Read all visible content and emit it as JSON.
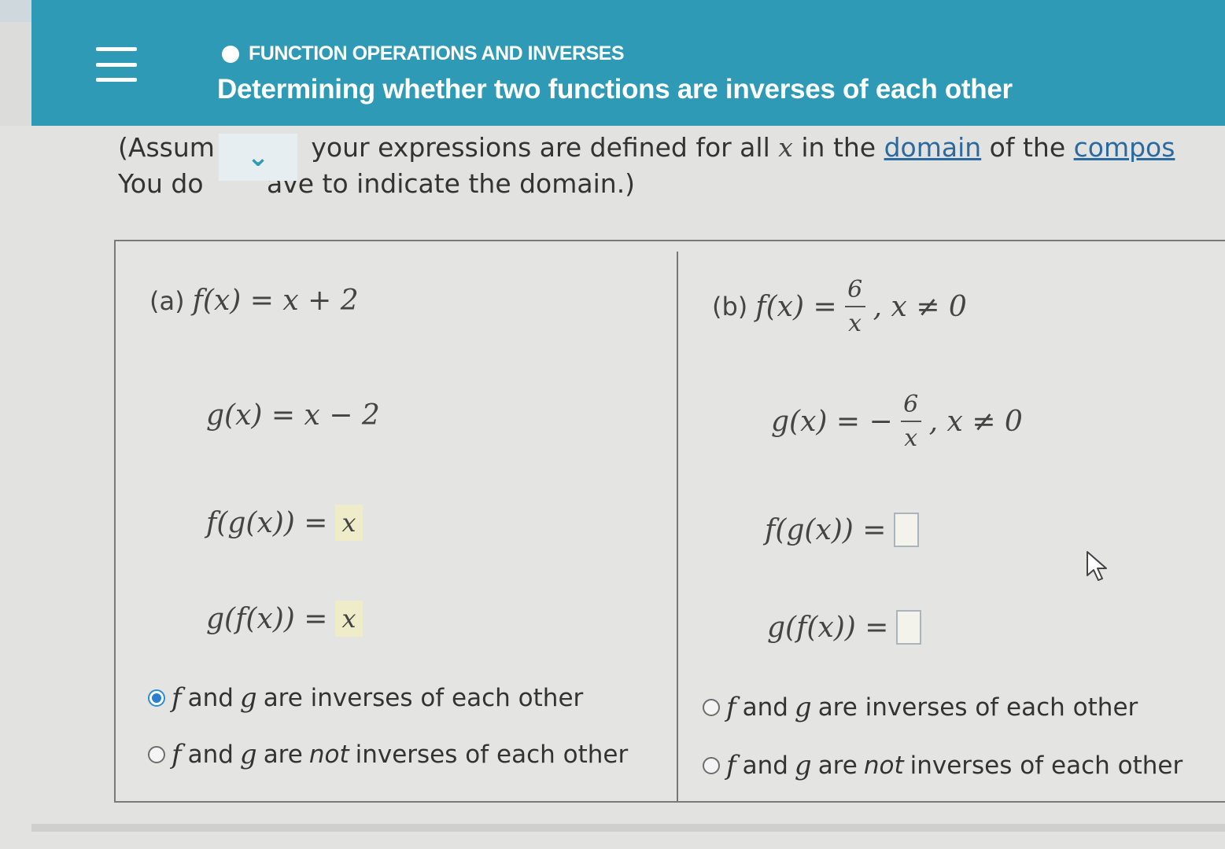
{
  "header": {
    "topic": "FUNCTION OPERATIONS AND INVERSES",
    "title": "Determining whether two functions are inverses of each other",
    "accent_color": "#2e9ab6",
    "menu_icon": "hamburger-icon",
    "collapse_icon": "chevron-down-icon"
  },
  "instructions": {
    "line1_start": "(Assum",
    "line1_mid": " your expressions are defined for all ",
    "line1_var": "x",
    "line1_in": " in the ",
    "domain_link": "domain",
    "line1_of": " of the ",
    "compos_link": "compos",
    "line2_start": "You do ",
    "line2_end": "ave to indicate the domain.)"
  },
  "part_a": {
    "label": "(a)",
    "f_def": "f(x) = x + 2",
    "g_def": "g(x) = x − 2",
    "fg_label": "f(g(x)) =",
    "fg_value": "x",
    "gf_label": "g(f(x)) =",
    "gf_value": "x",
    "choices": [
      {
        "f": "f",
        "t1": " and ",
        "g": "g",
        "t2": " are inverses of each other",
        "selected": true
      },
      {
        "f": "f",
        "t1": " and ",
        "g": "g",
        "t2a": " are ",
        "not": "not",
        "t2b": " inverses of each other",
        "selected": false
      }
    ]
  },
  "part_b": {
    "label": "(b)",
    "f_lhs": "f(x) =",
    "f_num": "6",
    "f_den": "x",
    "f_cond": ", x ≠ 0",
    "g_lhs": "g(x) = −",
    "g_num": "6",
    "g_den": "x",
    "g_cond": ", x ≠ 0",
    "fg_label": "f(g(x)) =",
    "fg_value": "",
    "gf_label": "g(f(x)) =",
    "gf_value": "",
    "choices": [
      {
        "f": "f",
        "t1": " and ",
        "g": "g",
        "t2": " are inverses of each other",
        "selected": false
      },
      {
        "f": "f",
        "t1": " and ",
        "g": "g",
        "t2a": " are ",
        "not": "not",
        "t2b": " inverses of each other",
        "selected": false
      }
    ]
  }
}
